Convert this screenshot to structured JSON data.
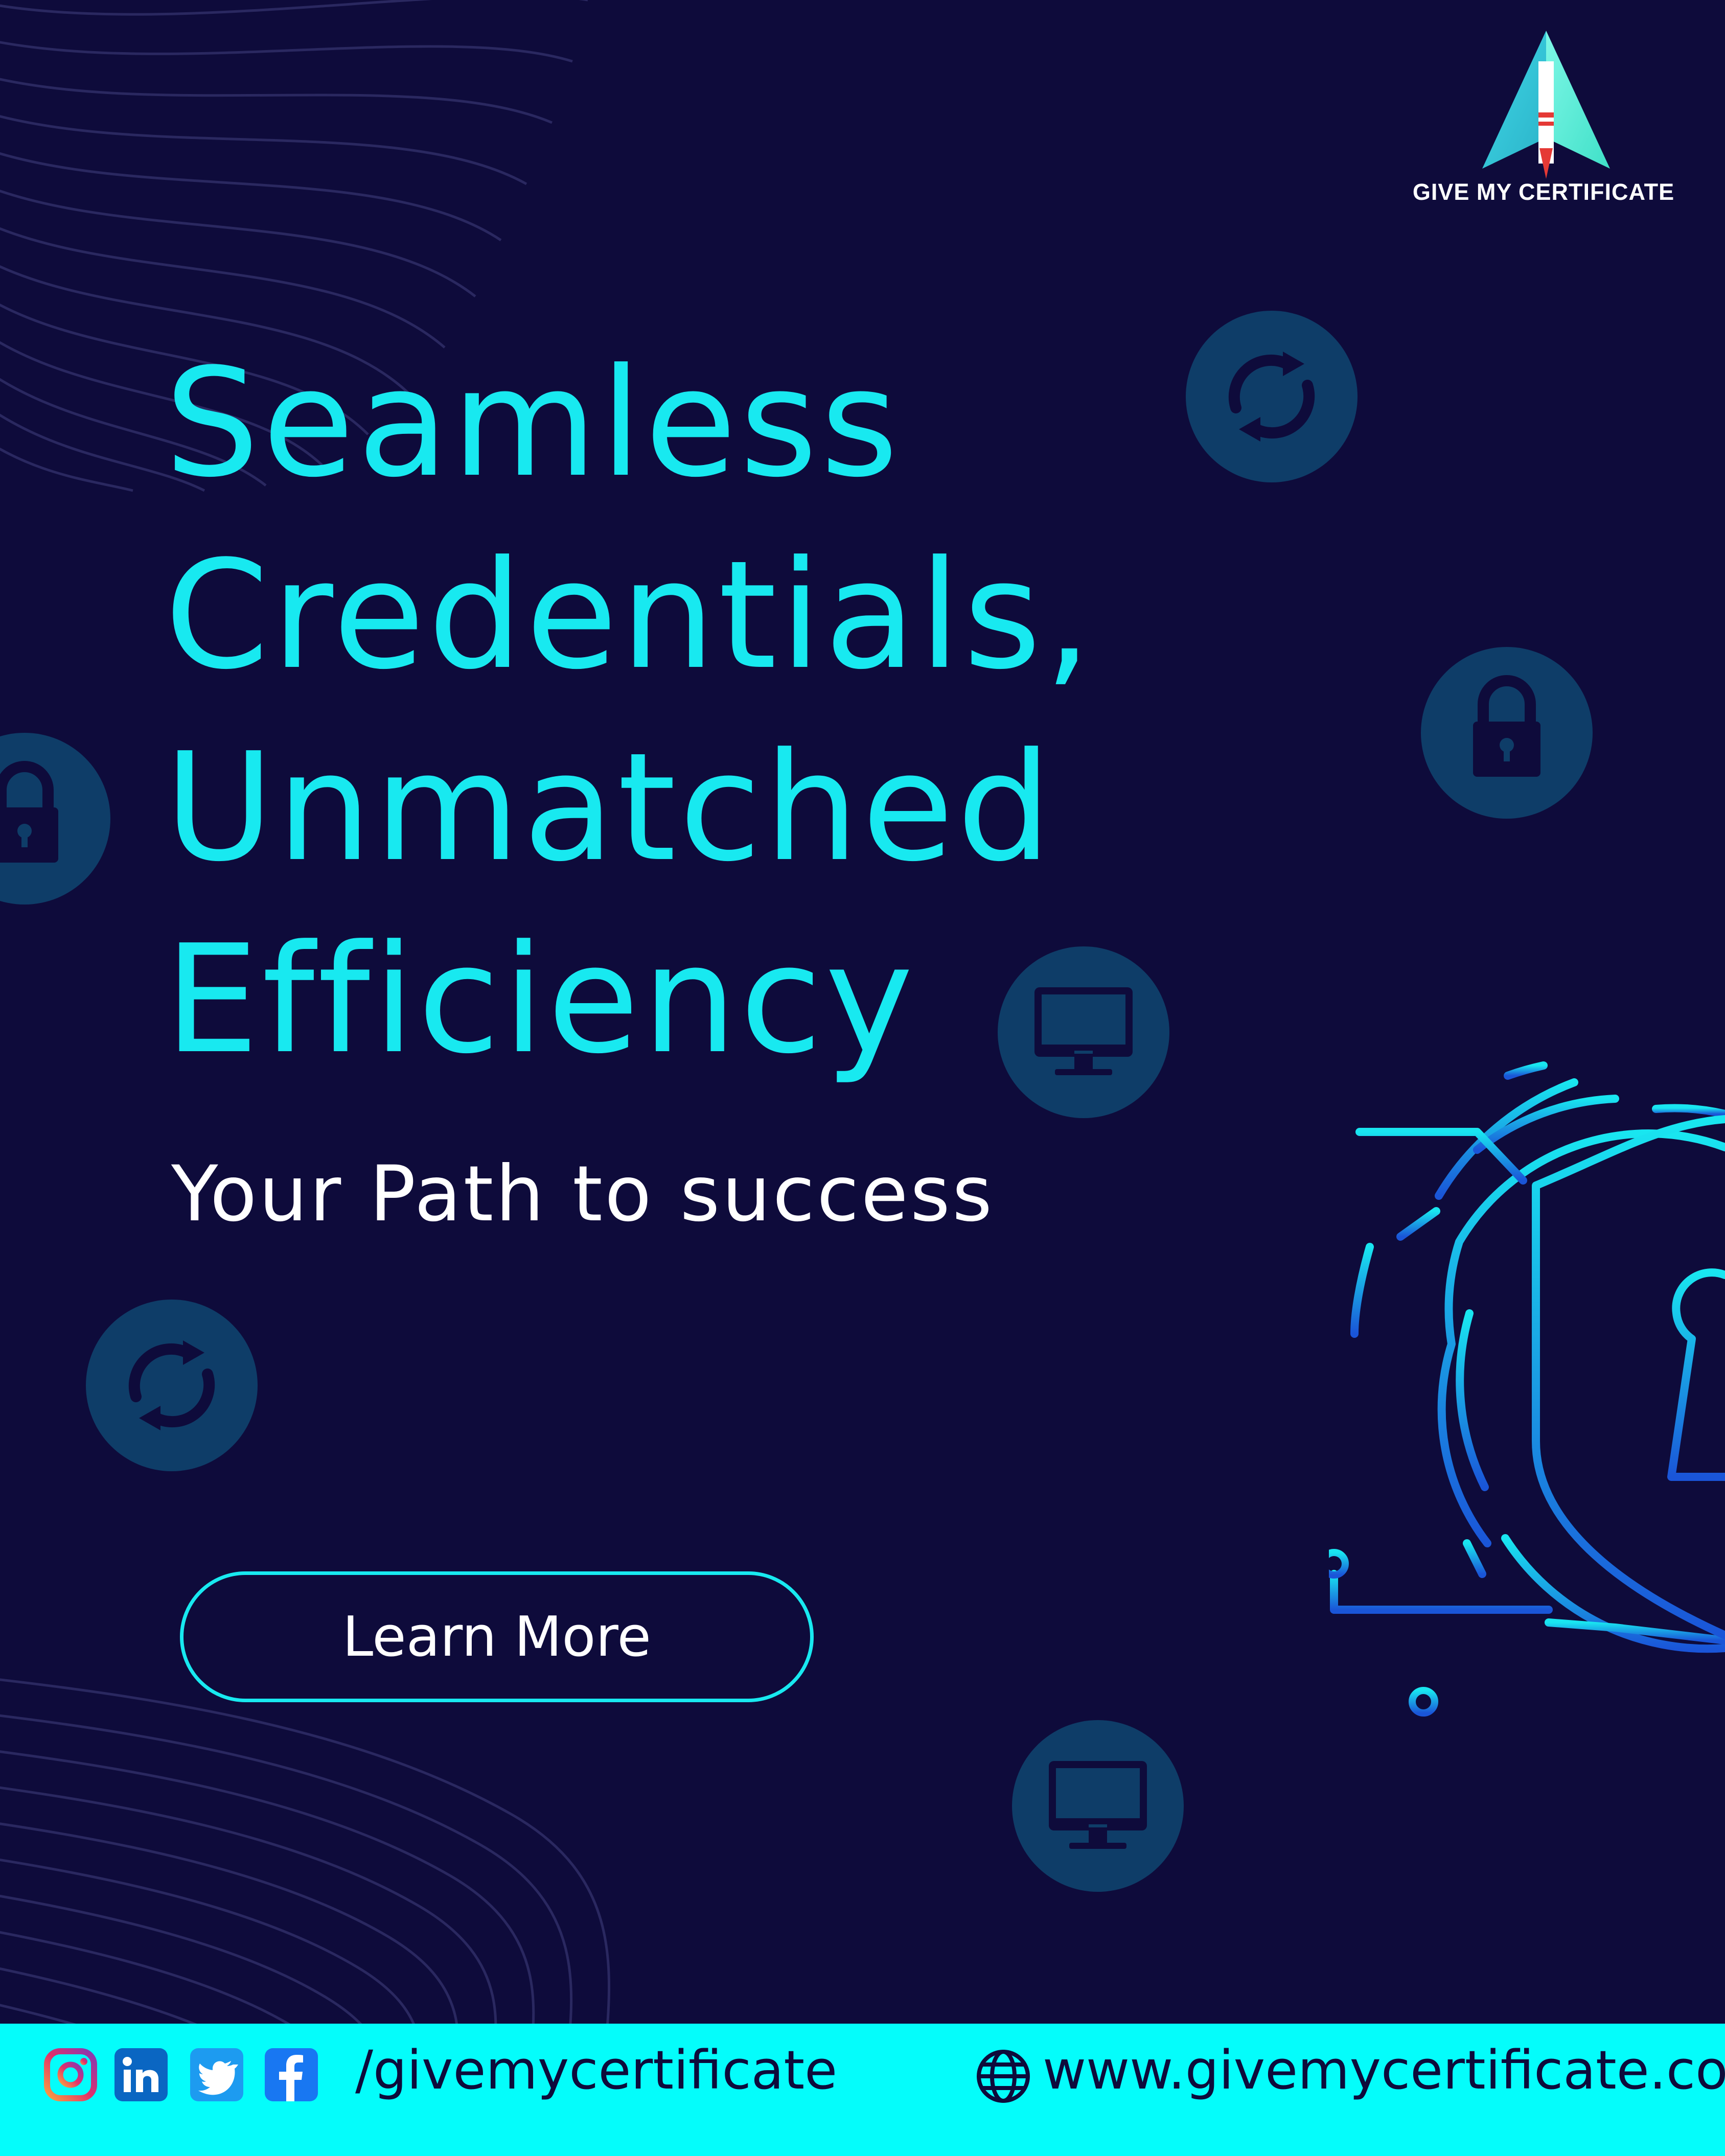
{
  "brand": {
    "name": "GIVE MY CERTIFICATE",
    "logo_icon": "paper-plane-certificate-icon"
  },
  "headline": {
    "lines": [
      "Seamless",
      "Credentials,",
      "Unmatched",
      "Efficiency"
    ]
  },
  "tagline": "Your Path to success",
  "cta": {
    "label": "Learn More"
  },
  "decorations": {
    "icons": [
      "refresh-icon",
      "lock-icon",
      "monitor-icon",
      "shield-keyhole-icon"
    ]
  },
  "footer": {
    "social_icons": [
      "instagram-icon",
      "linkedin-icon",
      "twitter-icon",
      "facebook-icon"
    ],
    "handle": "/givemycertificate",
    "website_icon": "globe-icon",
    "website": "www.givemycertificate.com"
  },
  "colors": {
    "background": "#0e0b3b",
    "accent": "#18e9f0",
    "footer": "#04fdfb",
    "badge": "#0e3d68"
  }
}
